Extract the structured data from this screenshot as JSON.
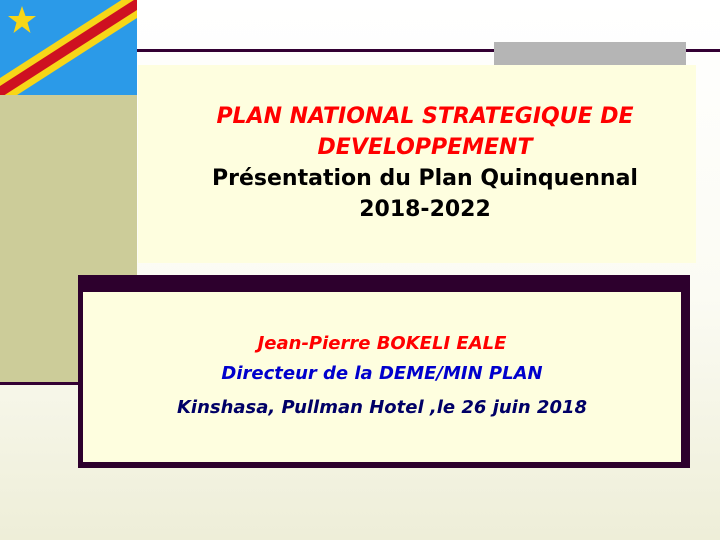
{
  "slide": {
    "title": {
      "line1": "PLAN NATIONAL STRATEGIQUE DE",
      "line2": "DEVELOPPEMENT",
      "line3": "Présentation du Plan Quinquennal",
      "line4": "2018-2022"
    },
    "presenter": {
      "name": "Jean-Pierre BOKELI EALE",
      "role": "Directeur de la DEME/MIN PLAN",
      "place_date": "Kinshasa, Pullman Hotel ,le 26 juin 2018"
    }
  },
  "colors": {
    "title_accent": "#ff0000",
    "role_blue": "#0000cc",
    "place_navy": "#000066",
    "frame_dark": "#2d002d",
    "panel_khaki": "#cccc99",
    "box_cream": "#fefedf",
    "flag_blue": "#2b9ae8",
    "flag_yellow": "#f7d618",
    "flag_red": "#ce1021"
  },
  "icons": {
    "flag": "drc-flag-icon"
  }
}
